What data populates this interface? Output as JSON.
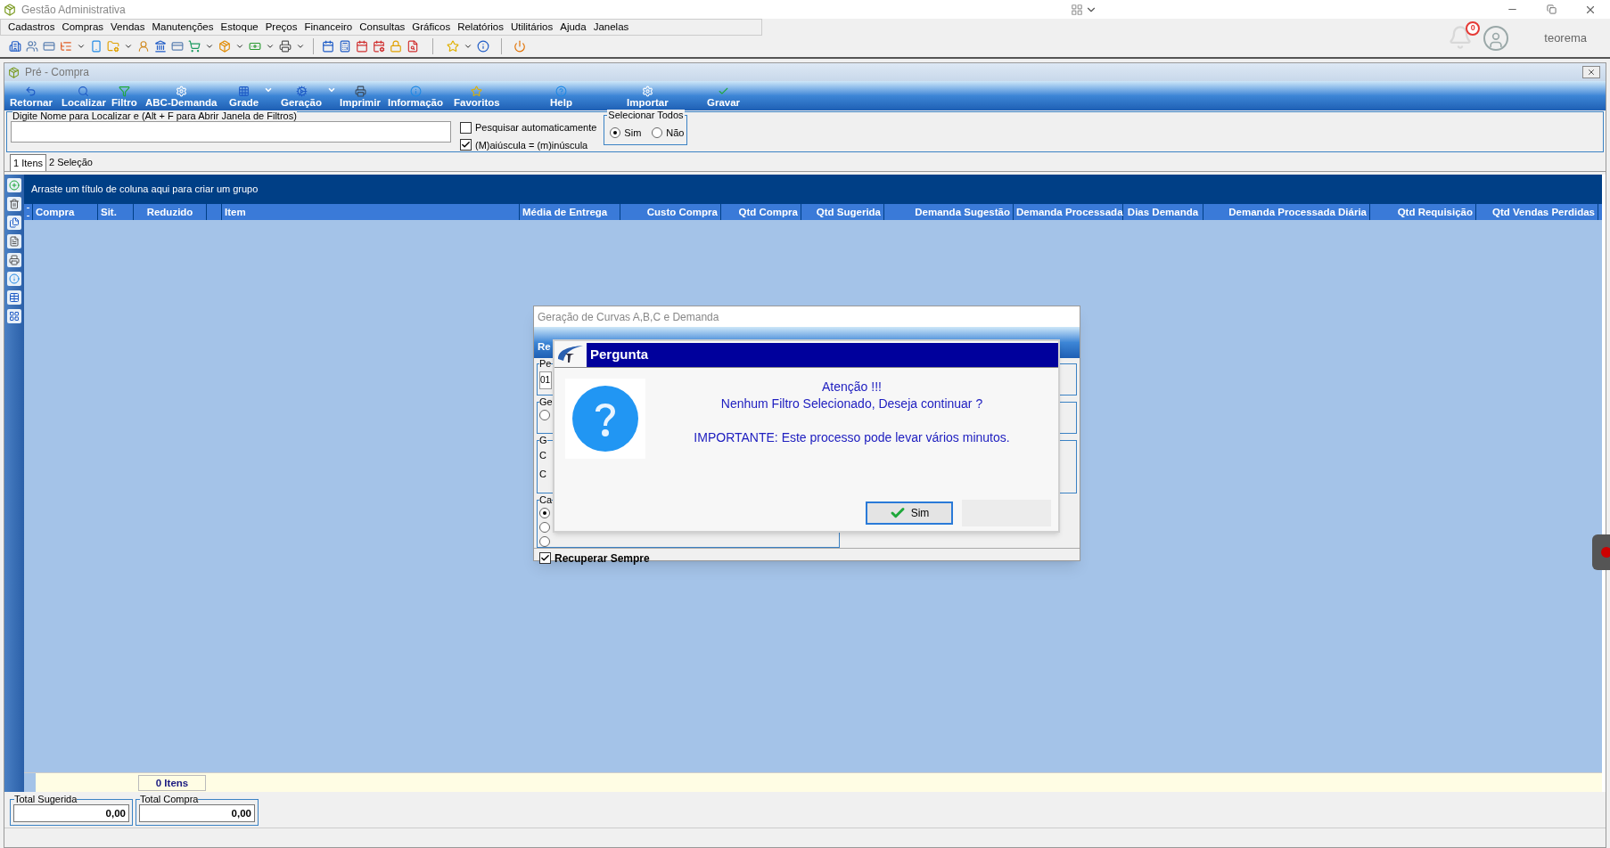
{
  "window": {
    "title": "Gestão Administrativa"
  },
  "menu": [
    "Cadastros",
    "Compras",
    "Vendas",
    "Manutenções",
    "Estoque",
    "Preços",
    "Financeiro",
    "Consultas",
    "Gráficos",
    "Relatórios",
    "Utilitários",
    "Ajuda",
    "Janelas"
  ],
  "user": {
    "notifications": "0",
    "name": "teorema"
  },
  "child_window": {
    "title": "Pré - Compra"
  },
  "ribbon": [
    {
      "label": "Retornar",
      "kind": "button"
    },
    {
      "label": "Localizar",
      "kind": "button"
    },
    {
      "label": "Filtro",
      "kind": "button"
    },
    {
      "label": "ABC-Demanda",
      "kind": "button"
    },
    {
      "label": "Grade",
      "kind": "dropdown"
    },
    {
      "label": "Geração",
      "kind": "dropdown"
    },
    {
      "label": "Imprimir",
      "kind": "button"
    },
    {
      "label": "Informação",
      "kind": "button"
    },
    {
      "label": "Favoritos",
      "kind": "button"
    },
    {
      "label": "Help",
      "kind": "button"
    },
    {
      "label": "Importar",
      "kind": "button"
    },
    {
      "label": "Gravar",
      "kind": "button"
    }
  ],
  "search": {
    "label": "Digite Nome para Localizar e (Alt + F para Abrir Janela de Filtros)"
  },
  "options": [
    {
      "label": "Pesquisar automaticamente",
      "checked": false
    },
    {
      "label": "(M)aiúscula = (m)inúscula",
      "checked": true
    }
  ],
  "select_all": {
    "title": "Selecionar Todos",
    "options": [
      {
        "label": "Sim",
        "selected": true
      },
      {
        "label": "Não",
        "selected": false
      }
    ]
  },
  "tabs": [
    {
      "label": "1 Itens",
      "selected": true
    },
    {
      "label": "2 Seleção",
      "selected": false
    }
  ],
  "grid": {
    "group_hint": "Arraste um título de coluna aqui para criar um grupo",
    "columns": [
      "Compra",
      "Sit.",
      "Reduzido",
      "Item",
      "Média de Entrega",
      "Custo Compra",
      "Qtd Compra",
      "Qtd Sugerida",
      "Demanda Sugestão",
      "Demanda Processada",
      "Dias Demanda",
      "Demanda Processada Diária",
      "Qtd Requisição",
      "Qtd Vendas Perdidas"
    ],
    "footer": "0 Itens"
  },
  "totals": [
    {
      "label": "Total Sugerida",
      "value": "0,00"
    },
    {
      "label": "Total Compra",
      "value": "0,00"
    }
  ],
  "background_dialog": {
    "title": "Geração de Curvas A,B,C e Demanda",
    "tab_fragment": "Re",
    "groups": [
      {
        "legend": "Pe",
        "value": "01"
      },
      {
        "legend": "Ge",
        "radios": [
          {
            "selected": false
          }
        ]
      },
      {
        "legend": "G",
        "items": [
          "C",
          "C"
        ]
      },
      {
        "legend": "Ca",
        "radios": [
          {
            "selected": true
          },
          {
            "selected": false
          },
          {
            "selected": false
          }
        ]
      }
    ],
    "recover": {
      "label": "Recuperar Sempre",
      "checked": true
    }
  },
  "question": {
    "title": "Pergunta",
    "lines": [
      "Atenção !!!",
      "Nenhum Filtro Selecionado, Deseja continuar ?",
      "IMPORTANTE: Este processo pode levar vários minutos."
    ],
    "button": "Sim"
  }
}
